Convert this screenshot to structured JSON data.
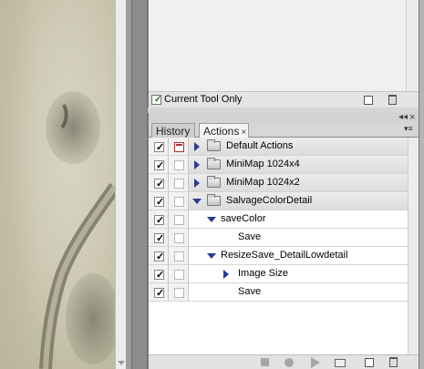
{
  "tool_options": {
    "current_tool_only_label": "Current Tool Only",
    "current_tool_only_checked": true
  },
  "panel": {
    "tabs": [
      {
        "label": "History",
        "active": false
      },
      {
        "label": "Actions",
        "active": true
      }
    ],
    "close_glyph": "×",
    "collapse_glyph": "◂◂",
    "menu_glyph": "▾≡"
  },
  "actions": [
    {
      "label": "Default Actions",
      "kind": "set",
      "expanded": false,
      "dialog_toggle": true
    },
    {
      "label": "MiniMap 1024x4",
      "kind": "set",
      "expanded": false,
      "dialog_toggle": false
    },
    {
      "label": "MiniMap 1024x2",
      "kind": "set",
      "expanded": false,
      "dialog_toggle": false
    },
    {
      "label": "SalvageColorDetail",
      "kind": "set",
      "expanded": true,
      "dialog_toggle": false
    },
    {
      "label": "saveColor",
      "kind": "action",
      "expanded": true,
      "dialog_toggle": false
    },
    {
      "label": "Save",
      "kind": "command",
      "expanded": false,
      "dialog_toggle": false
    },
    {
      "label": "ResizeSave_DetailLowdetail",
      "kind": "action",
      "expanded": true,
      "dialog_toggle": false
    },
    {
      "label": "Image Size",
      "kind": "command",
      "expanded": false,
      "dialog_toggle": false
    },
    {
      "label": "Save",
      "kind": "command",
      "expanded": false,
      "dialog_toggle": false
    }
  ],
  "icons": {
    "upper_footer": [
      "new-icon",
      "trash-icon"
    ],
    "bottom_bar": [
      "stop-icon",
      "record-icon",
      "play-icon",
      "new-set-icon",
      "new-action-icon",
      "delete-icon"
    ]
  }
}
